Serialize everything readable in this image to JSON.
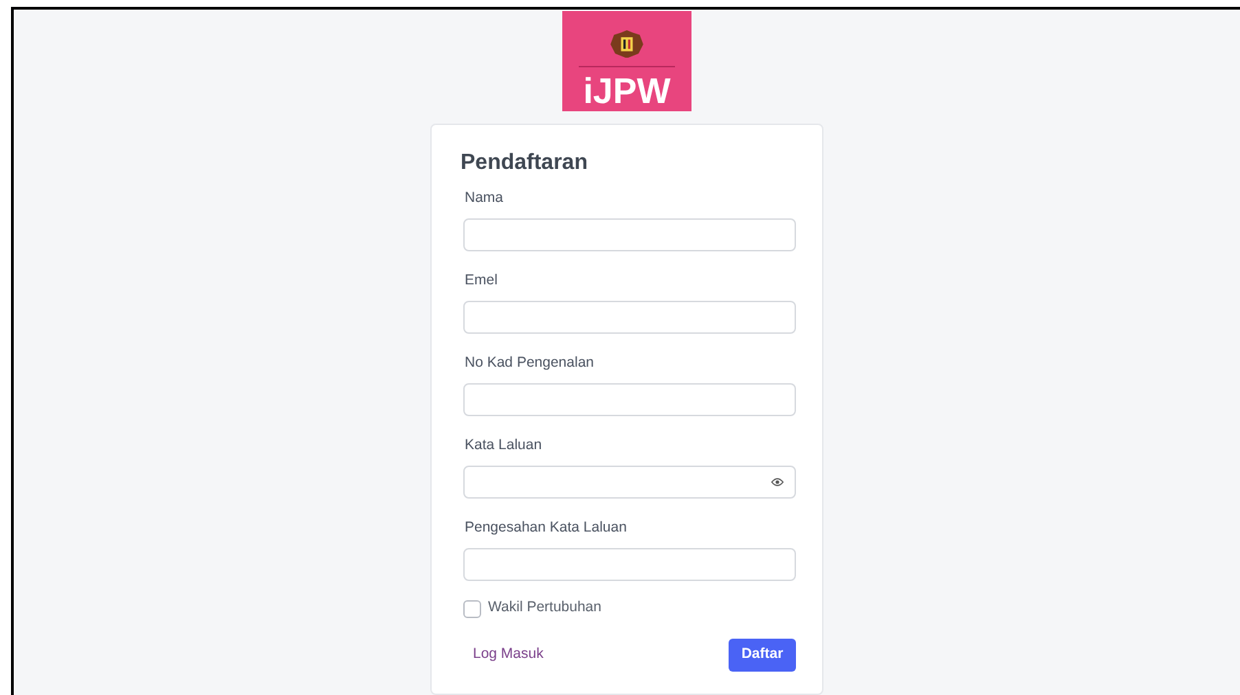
{
  "logo": {
    "text": "iJPW"
  },
  "form": {
    "title": "Pendaftaran",
    "fields": [
      {
        "label": "Nama",
        "kind": "text"
      },
      {
        "label": "Emel",
        "kind": "text"
      },
      {
        "label": "No Kad Pengenalan",
        "kind": "text"
      },
      {
        "label": "Kata Laluan",
        "kind": "password"
      },
      {
        "label": "Pengesahan Kata Laluan",
        "kind": "text"
      }
    ],
    "checkbox": {
      "label": "Wakil Pertubuhan",
      "checked": false
    },
    "link": "Log Masuk",
    "submit": "Daftar"
  }
}
